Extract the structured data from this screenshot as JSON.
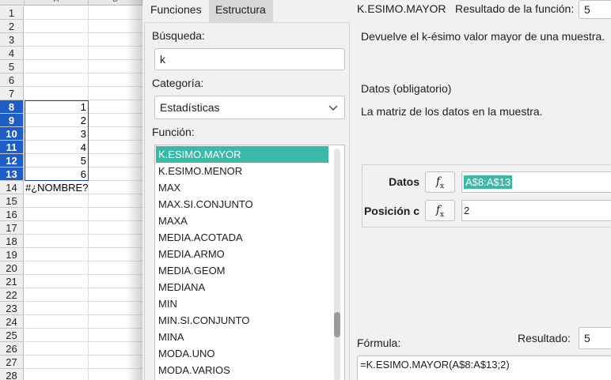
{
  "sheet": {
    "columns": [
      "A",
      "B"
    ],
    "rows": [
      {
        "num": "1",
        "value": ""
      },
      {
        "num": "2",
        "value": ""
      },
      {
        "num": "3",
        "value": ""
      },
      {
        "num": "4",
        "value": ""
      },
      {
        "num": "5",
        "value": ""
      },
      {
        "num": "6",
        "value": ""
      },
      {
        "num": "7",
        "value": ""
      },
      {
        "num": "8",
        "value": "1"
      },
      {
        "num": "9",
        "value": "2"
      },
      {
        "num": "10",
        "value": "3"
      },
      {
        "num": "11",
        "value": "4"
      },
      {
        "num": "12",
        "value": "5"
      },
      {
        "num": "13",
        "value": "6"
      },
      {
        "num": "14",
        "value": "#¿NOMBRE?"
      },
      {
        "num": "15",
        "value": ""
      },
      {
        "num": "16",
        "value": ""
      },
      {
        "num": "17",
        "value": ""
      },
      {
        "num": "18",
        "value": ""
      },
      {
        "num": "19",
        "value": ""
      },
      {
        "num": "20",
        "value": ""
      },
      {
        "num": "21",
        "value": ""
      },
      {
        "num": "22",
        "value": ""
      },
      {
        "num": "23",
        "value": ""
      },
      {
        "num": "24",
        "value": ""
      },
      {
        "num": "25",
        "value": ""
      },
      {
        "num": "26",
        "value": ""
      },
      {
        "num": "27",
        "value": ""
      },
      {
        "num": "28",
        "value": ""
      }
    ]
  },
  "dialog": {
    "tabs": {
      "functions": "Funciones",
      "structure": "Estructura"
    },
    "search": {
      "label": "Búsqueda:",
      "value": "k"
    },
    "category": {
      "label": "Categoría:",
      "value": "Estadísticas"
    },
    "function_label": "Función:",
    "functions": [
      "K.ESIMO.MAYOR",
      "K.ESIMO.MENOR",
      "MAX",
      "MAX.SI.CONJUNTO",
      "MAXA",
      "MEDIA.ACOTADA",
      "MEDIA.ARMO",
      "MEDIA.GEOM",
      "MEDIANA",
      "MIN",
      "MIN.SI.CONJUNTO",
      "MINA",
      "MODA.UNO",
      "MODA.VARIOS"
    ],
    "selected_function": "K.ESIMO.MAYOR",
    "function_name": "K.ESIMO.MAYOR",
    "result_label": "Resultado de la función:",
    "result_value": "5",
    "description": "Devuelve el k-ésimo valor mayor de una muestra.",
    "param_required": "Datos (obligatorio)",
    "param_description": "La matriz de los datos en la muestra.",
    "params": [
      {
        "label": "Datos",
        "value": "A$8:A$13"
      },
      {
        "label": "Posición c",
        "value": "2"
      }
    ],
    "fx_label": "f",
    "fx_sub": "x",
    "formula_label": "Fórmula:",
    "result2_label": "Resultado:",
    "result2_value": "5",
    "formula": "=K.ESIMO.MAYOR(A$8:A$13;2)"
  },
  "colors": {
    "selection": "#3cb8a6",
    "row_highlight": "#1e5cc8"
  }
}
